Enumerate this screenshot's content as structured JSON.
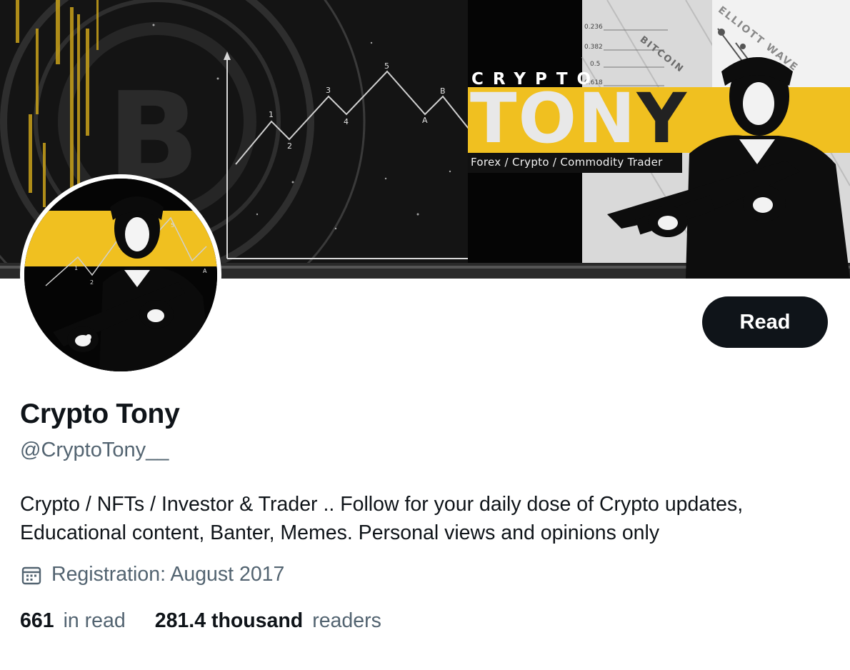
{
  "banner": {
    "crypto_word": "CRYPTO",
    "tony_word_light": "TON",
    "tony_word_dark": "Y",
    "subtitle": "Forex / Crypto / Commodity Trader",
    "corner_text": "ELLIOTT WAVE",
    "diagonal_text": "BITCOIN",
    "accent_color": "#f0c020"
  },
  "profile": {
    "display_name": "Crypto Tony",
    "handle": "@CryptoTony__",
    "bio": "Crypto / NFTs / Investor & Trader .. Follow for your daily dose of Crypto updates, Educational content, Banter, Memes. Personal views and opinions only",
    "registration": "Registration: August 2017",
    "calendar_icon": "calendar-icon",
    "read_button_label": "Read"
  },
  "stats": {
    "following_count": "661",
    "following_label": "in read",
    "followers_count": "281.4 thousand",
    "followers_label": "readers"
  }
}
